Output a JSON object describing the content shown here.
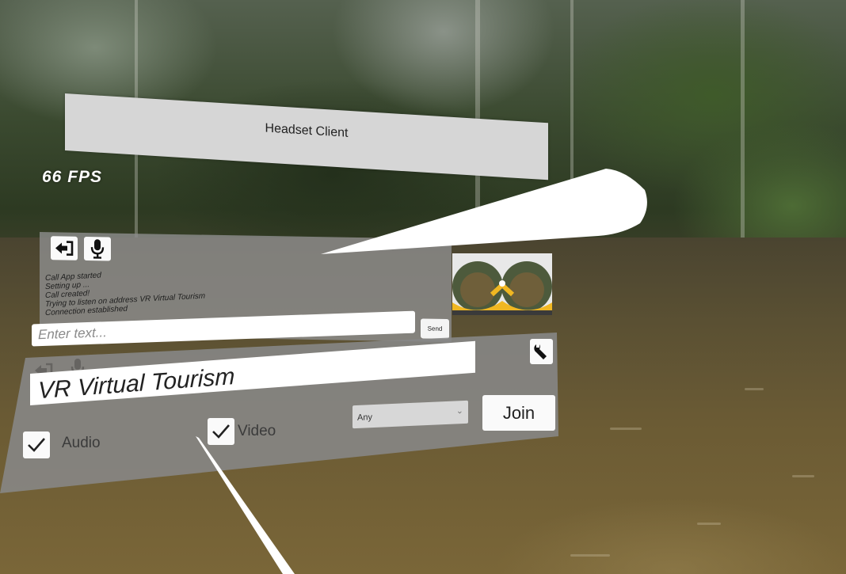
{
  "header": {
    "title": "Headset Client"
  },
  "fps": "66 FPS",
  "chat": {
    "log": [
      "Call App started",
      "Setting up ...",
      "Call created!",
      "Trying to listen on address VR Virtual Tourism",
      "Connection established"
    ],
    "input_placeholder": "Enter text...",
    "send_label": "Send"
  },
  "join": {
    "room_name": "VR Virtual Tourism",
    "audio_label": "Audio",
    "audio_checked": true,
    "video_label": "Video",
    "video_checked": true,
    "device_selected": "Any",
    "join_label": "Join"
  },
  "icons": {
    "leave": "sign-out-icon",
    "mic": "microphone-icon",
    "settings": "wrench-icon",
    "check": "checkmark-icon"
  },
  "colors": {
    "panel_gray": "#8c8c8c",
    "header_panel": "#d6d6d6",
    "laser": "#ffffff",
    "thumb_accent": "#f0b722"
  }
}
